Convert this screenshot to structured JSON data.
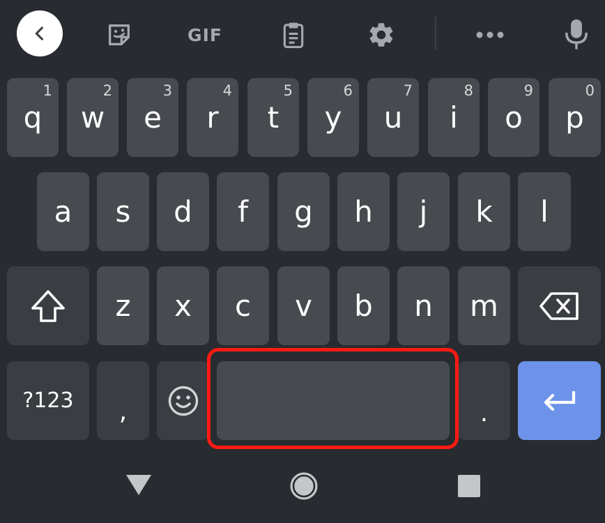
{
  "toolbar": {
    "gif_label": "GIF",
    "icons": [
      "back-icon",
      "sticker-icon",
      "gif-icon",
      "clipboard-icon",
      "settings-icon",
      "more-icon",
      "mic-icon"
    ]
  },
  "keyboard": {
    "row1": [
      {
        "letter": "q",
        "hint": "1"
      },
      {
        "letter": "w",
        "hint": "2"
      },
      {
        "letter": "e",
        "hint": "3"
      },
      {
        "letter": "r",
        "hint": "4"
      },
      {
        "letter": "t",
        "hint": "5"
      },
      {
        "letter": "y",
        "hint": "6"
      },
      {
        "letter": "u",
        "hint": "7"
      },
      {
        "letter": "i",
        "hint": "8"
      },
      {
        "letter": "o",
        "hint": "9"
      },
      {
        "letter": "p",
        "hint": "0"
      }
    ],
    "row2": [
      "a",
      "s",
      "d",
      "f",
      "g",
      "h",
      "j",
      "k",
      "l"
    ],
    "row3": [
      "z",
      "x",
      "c",
      "v",
      "b",
      "n",
      "m"
    ],
    "symbols_label": "?123",
    "comma_label": ",",
    "period_label": ".",
    "space_label": "",
    "icons": [
      "shift-icon",
      "backspace-icon",
      "emoji-icon",
      "enter-icon"
    ]
  },
  "colors": {
    "background": "#282b30",
    "key": "#474a4f",
    "special_key": "#3a3d42",
    "enter_key": "#6c93e9",
    "highlight": "#ff1a12"
  },
  "navbar": {
    "icons": [
      "nav-back-icon",
      "nav-home-icon",
      "nav-recents-icon"
    ]
  }
}
